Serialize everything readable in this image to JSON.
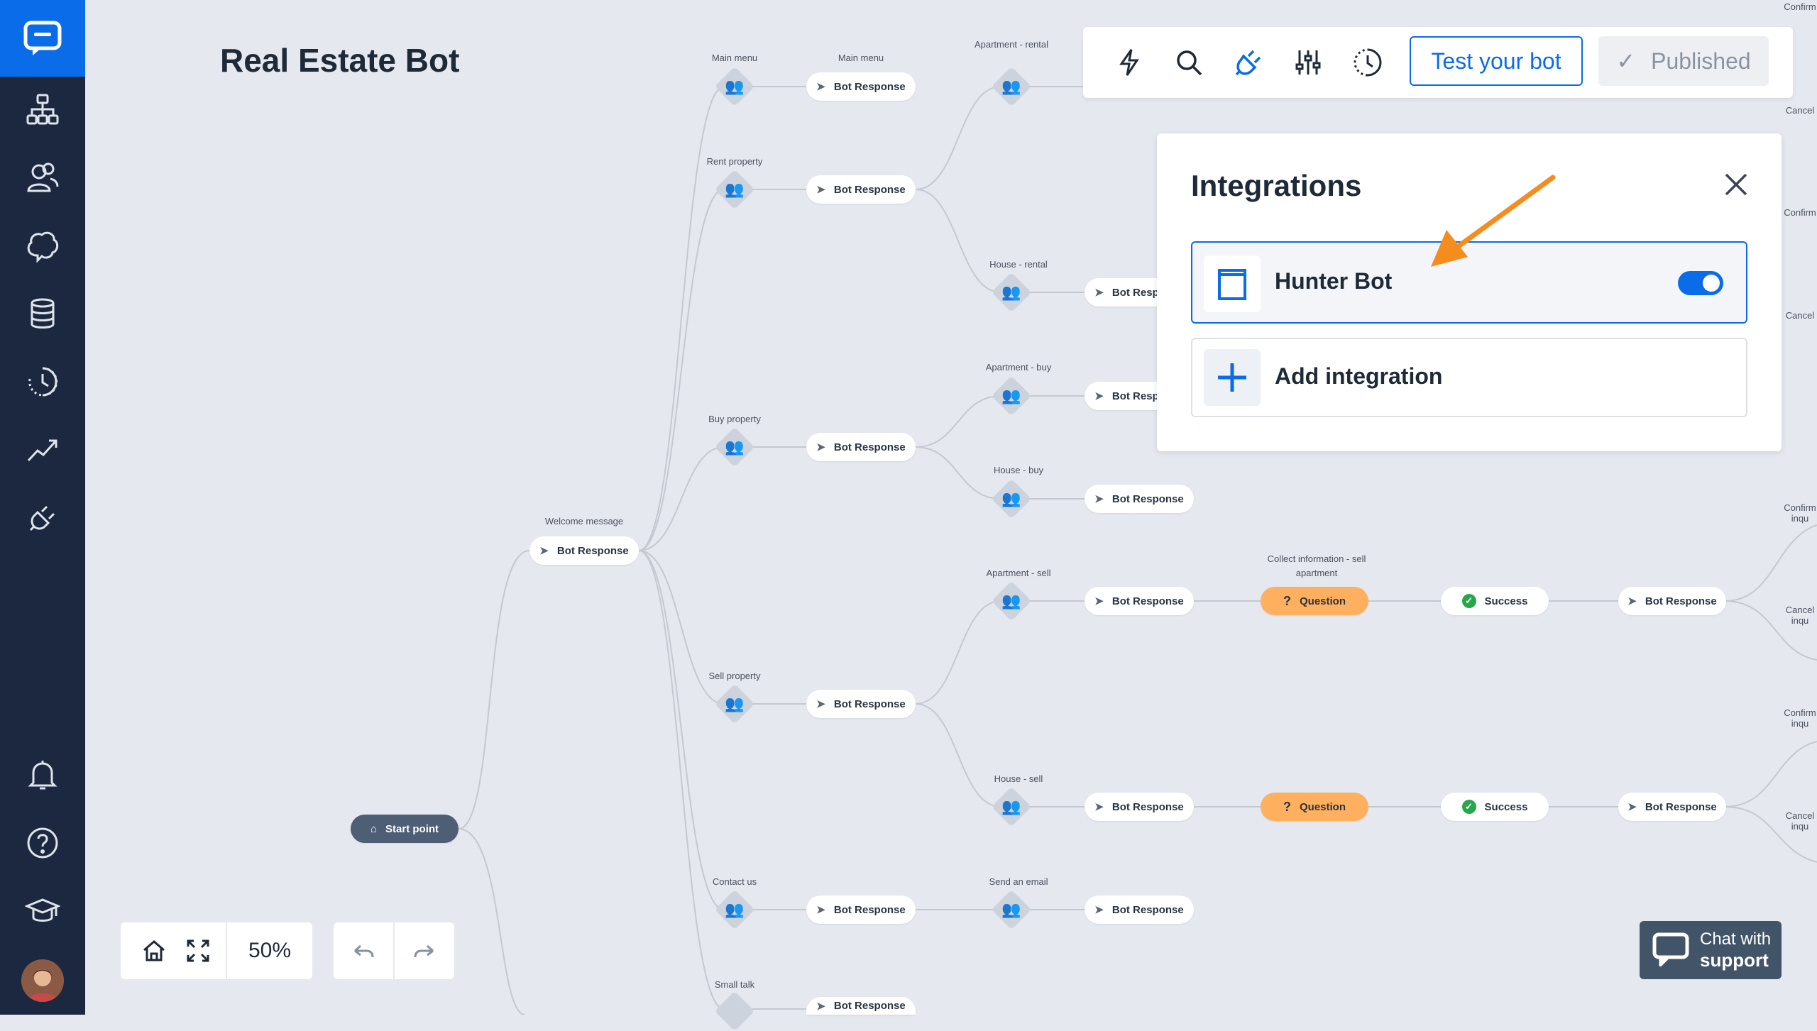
{
  "app": {
    "title": "Real Estate Bot"
  },
  "sidebar": {
    "items": [
      {
        "icon": "chat-logo-icon"
      },
      {
        "icon": "flow-icon"
      },
      {
        "icon": "users-icon"
      },
      {
        "icon": "brain-icon"
      },
      {
        "icon": "database-icon"
      },
      {
        "icon": "history-icon"
      },
      {
        "icon": "analytics-icon"
      },
      {
        "icon": "integrations-icon"
      },
      {
        "icon": "bell-icon"
      },
      {
        "icon": "help-icon"
      },
      {
        "icon": "academy-icon"
      },
      {
        "icon": "avatar"
      }
    ]
  },
  "toolbar": {
    "test_label": "Test your bot",
    "published_label": "Published"
  },
  "integrations": {
    "title": "Integrations",
    "items": [
      {
        "name": "Hunter Bot",
        "enabled": true
      },
      {
        "name": "Add integration"
      }
    ]
  },
  "zoom": {
    "value": "50%"
  },
  "support": {
    "line1": "Chat with",
    "line2": "support"
  },
  "flow": {
    "start": "Start point",
    "welcome_label": "Welcome message",
    "bot_response": "Bot Response",
    "question": "Question",
    "success": "Success",
    "labels": {
      "main_menu": "Main menu",
      "main_menu2": "Main menu",
      "rent_property": "Rent property",
      "buy_property": "Buy property",
      "sell_property": "Sell property",
      "contact_us": "Contact us",
      "small_talk": "Small talk",
      "apartment_rental": "Apartment - rental",
      "house_rental": "House - rental",
      "apartment_buy": "Apartment - buy",
      "house_buy": "House - buy",
      "apartment_sell": "Apartment - sell",
      "house_sell": "House - sell",
      "send_email": "Send an email",
      "collect_info": "Collect information - sell apartment",
      "right_labels": [
        "Confirm",
        "Cancel",
        "Confirm",
        "Cancel",
        "Confirm inqu",
        "Cancel inqu",
        "Confirm inqu",
        "Cancel inqu"
      ]
    }
  }
}
